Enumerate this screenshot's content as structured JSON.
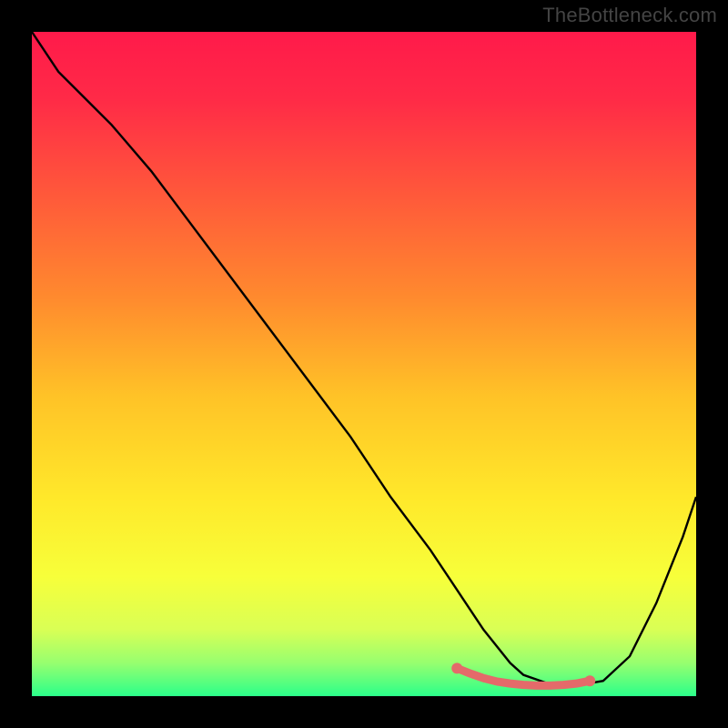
{
  "watermark": "TheBottleneck.com",
  "chart_data": {
    "type": "line",
    "title": "",
    "xlabel": "",
    "ylabel": "",
    "xlim": [
      0,
      100
    ],
    "ylim": [
      0,
      100
    ],
    "series": [
      {
        "name": "curve",
        "x": [
          0,
          4,
          8,
          12,
          18,
          24,
          30,
          36,
          42,
          48,
          54,
          60,
          64,
          68,
          72,
          74,
          78,
          82,
          86,
          90,
          94,
          98,
          100
        ],
        "y": [
          100,
          94,
          90,
          86,
          79,
          71,
          63,
          55,
          47,
          39,
          30,
          22,
          16,
          10,
          5,
          3.2,
          1.8,
          1.6,
          2.3,
          6,
          14,
          24,
          30
        ]
      },
      {
        "name": "highlight",
        "x": [
          64,
          66,
          68,
          70,
          72,
          74,
          76,
          78,
          80,
          82,
          84
        ],
        "y": [
          4.2,
          3.4,
          2.7,
          2.2,
          1.9,
          1.7,
          1.6,
          1.6,
          1.7,
          1.9,
          2.3
        ]
      },
      {
        "name": "highlight-dots-x",
        "values": [
          64,
          84
        ]
      }
    ],
    "axes_visible": false,
    "grid": false,
    "gradient": {
      "stops": [
        {
          "offset": 0.0,
          "color": "#ff1a4a"
        },
        {
          "offset": 0.1,
          "color": "#ff2a47"
        },
        {
          "offset": 0.25,
          "color": "#ff5a3a"
        },
        {
          "offset": 0.4,
          "color": "#ff8a2e"
        },
        {
          "offset": 0.55,
          "color": "#ffc327"
        },
        {
          "offset": 0.7,
          "color": "#ffe82a"
        },
        {
          "offset": 0.82,
          "color": "#f7ff3a"
        },
        {
          "offset": 0.9,
          "color": "#d9ff55"
        },
        {
          "offset": 0.95,
          "color": "#97ff6f"
        },
        {
          "offset": 1.0,
          "color": "#2bff8a"
        }
      ]
    },
    "colors": {
      "curve": "#000000",
      "highlight": "#e46a6a",
      "background_frame": "#000000"
    }
  }
}
